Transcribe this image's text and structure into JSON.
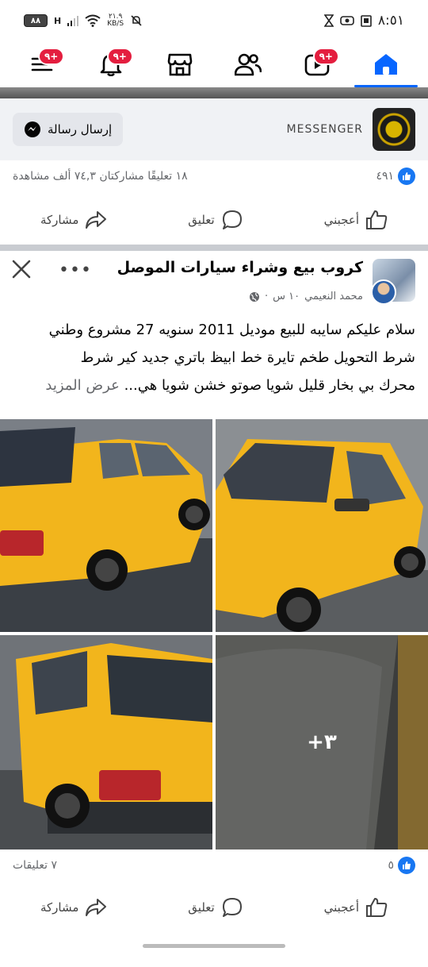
{
  "status_bar": {
    "time": "٨:٥١",
    "battery": "٨٨",
    "network": "H",
    "speed_value": "٢١.٩",
    "speed_unit": "KB/S"
  },
  "nav": {
    "badges": {
      "menu": "٩+",
      "notifications": "٩+",
      "video": "٩+"
    }
  },
  "messenger_bar": {
    "label": "MESSENGER",
    "button": "إرسال رسالة"
  },
  "prev_post": {
    "likes": "٤٩١",
    "stats": "١٨ تعليقًا  مشاركتان  ٧٤,٣ ألف مشاهدة",
    "actions": {
      "like": "أعجبني",
      "comment": "تعليق",
      "share": "مشاركة"
    }
  },
  "post": {
    "group_name": "كروب بيع وشراء سيارات الموصل",
    "author": "محمد النعيمي",
    "time": "١٠ س",
    "text_lines": [
      "سلام عليكم سايبه للبيع موديل 2011 سنويه 27 مشروع وطني",
      "شرط التحويل طخم تايرة خط ابيظ  باتري جديد كير شرط",
      "محرك بي بخار قليل شويا صوتو خشن شويا هي..."
    ],
    "see_more": "عرض المزيد",
    "more_photos": "+٣",
    "likes": "٥",
    "comments": "٧ تعليقات",
    "actions": {
      "like": "أعجبني",
      "comment": "تعليق",
      "share": "مشاركة"
    }
  },
  "colors": {
    "accent": "#0866ff",
    "badge": "#e41e3f",
    "car": "#f2b51c"
  }
}
